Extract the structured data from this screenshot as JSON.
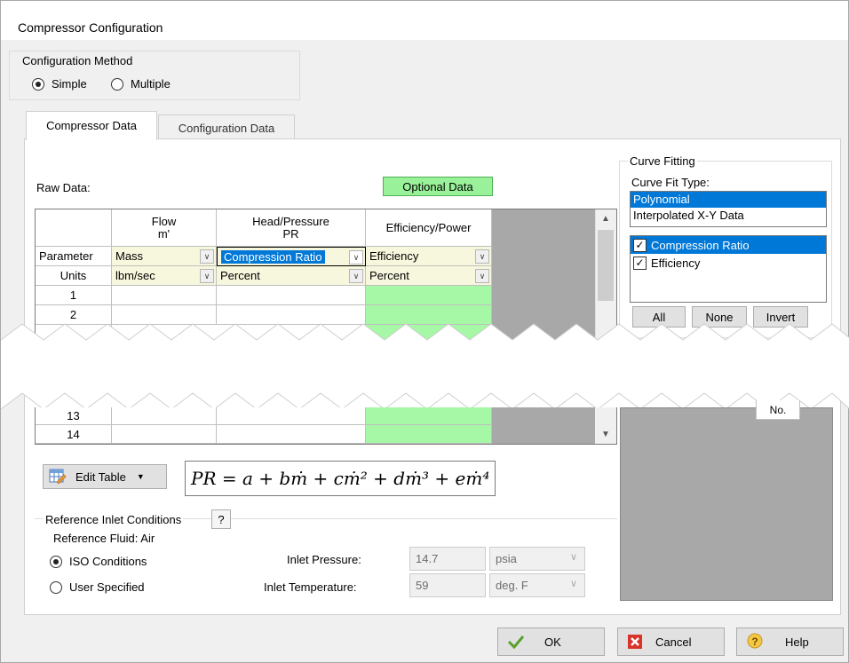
{
  "window": {
    "title": "Compressor Configuration"
  },
  "config_method": {
    "legend": "Configuration Method",
    "options": [
      {
        "label": "Simple",
        "selected": true
      },
      {
        "label": "Multiple",
        "selected": false
      }
    ]
  },
  "tabs": [
    {
      "label": "Compressor Data",
      "active": true
    },
    {
      "label": "Configuration Data",
      "active": false
    }
  ],
  "raw_data": {
    "label": "Raw Data:",
    "optional_badge": "Optional Data",
    "columns": [
      {
        "line1": "Flow",
        "line2": "m'"
      },
      {
        "line1": "Head/Pressure",
        "line2": "PR"
      },
      {
        "line1": "Efficiency/Power",
        "line2": ""
      }
    ],
    "parameter_row": {
      "label": "Parameter",
      "values": [
        "Mass",
        "Compression Ratio",
        "Efficiency"
      ]
    },
    "units_row": {
      "label": "Units",
      "values": [
        "lbm/sec",
        "Percent",
        "Percent"
      ]
    },
    "row_numbers_top": [
      "1",
      "2"
    ],
    "row_numbers_bottom": [
      "13",
      "14"
    ]
  },
  "curve_fitting": {
    "legend": "Curve Fitting",
    "fit_type_label": "Curve Fit Type:",
    "fit_types": [
      {
        "label": "Polynomial",
        "selected": true
      },
      {
        "label": "Interpolated X-Y Data",
        "selected": false
      }
    ],
    "curves": [
      {
        "label": "Compression Ratio",
        "checked": true,
        "selected": true
      },
      {
        "label": "Efficiency",
        "checked": true,
        "selected": false
      }
    ],
    "buttons": {
      "all": "All",
      "none": "None",
      "invert": "Invert"
    },
    "partial_tab": "No."
  },
  "edit_table": {
    "label": "Edit Table"
  },
  "equation": "PR = a + bṁ + cṁ² + dṁ³ + eṁ⁴",
  "reference": {
    "legend": "Reference Inlet Conditions",
    "help": "?",
    "fluid": "Reference Fluid: Air",
    "options": [
      {
        "label": "ISO Conditions",
        "selected": true
      },
      {
        "label": "User Specified",
        "selected": false
      }
    ],
    "inlet_pressure": {
      "label": "Inlet Pressure:",
      "value": "14.7",
      "unit": "psia"
    },
    "inlet_temperature": {
      "label": "Inlet Temperature:",
      "value": "59",
      "unit": "deg. F"
    }
  },
  "footer": {
    "ok": "OK",
    "cancel": "Cancel",
    "help": "Help"
  },
  "colors": {
    "accent": "#0078d7",
    "green_cell": "#a6f7a6",
    "optional_green": "#99f299",
    "dropdown_cell": "#f7f7de",
    "gray_area": "#a8a8a8"
  },
  "icons": [
    "checkmark-icon",
    "x-icon",
    "help-bulb-icon",
    "edit-table-icon",
    "chevron-down-icon",
    "scroll-up-icon",
    "scroll-down-icon"
  ]
}
